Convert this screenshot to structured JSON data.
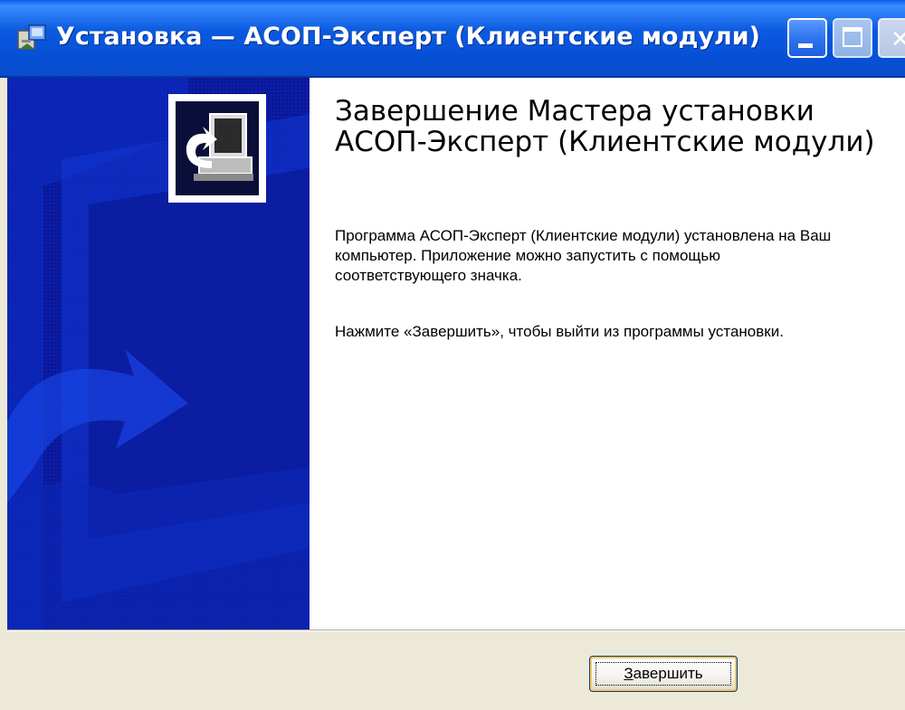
{
  "window": {
    "title": "Установка — АСОП-Эксперт (Клиентские модули)"
  },
  "content": {
    "heading": "Завершение Мастера установки АСОП-Эксперт (Клиентские модули)",
    "paragraph1": "Программа АСОП-Эксперт (Клиентские модули) установлена на Ваш компьютер. Приложение можно запустить с помощью соответствующего значка.",
    "paragraph2": "Нажмите «Завершить», чтобы выйти из программы установки."
  },
  "buttons": {
    "finish_mnemonic": "З",
    "finish_rest": "авершить"
  },
  "icons": {
    "title_icon": "installer-icon",
    "banner_logo": "computer-setup-icon"
  },
  "colors": {
    "titlebar": "#0650d6",
    "banner": "#0a1aa0",
    "dialog_face": "#ece9d8"
  }
}
